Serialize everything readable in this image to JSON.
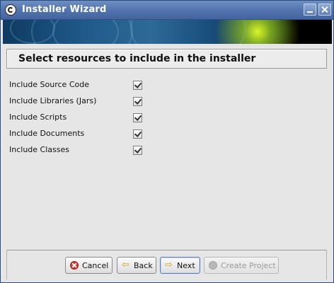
{
  "window": {
    "title": "Installer Wizard"
  },
  "heading": "Select resources to include in the installer",
  "options": [
    {
      "label": "Include Source Code",
      "checked": true
    },
    {
      "label": "Include Libraries (Jars)",
      "checked": true
    },
    {
      "label": "Include Scripts",
      "checked": true
    },
    {
      "label": "Include Documents",
      "checked": true
    },
    {
      "label": "Include Classes",
      "checked": true
    }
  ],
  "buttons": {
    "cancel": "Cancel",
    "back": "Back",
    "next": "Next",
    "create_project": "Create Project"
  },
  "colors": {
    "titlebar": "#5577b0",
    "banner_accent": "#e6ff28"
  },
  "icons": {
    "app": "app-logo-icon",
    "minimize": "minimize-icon",
    "close": "close-icon",
    "cancel": "cancel-icon",
    "back": "back-arrow-icon",
    "next": "next-arrow-icon",
    "create_project": "create-project-icon"
  }
}
